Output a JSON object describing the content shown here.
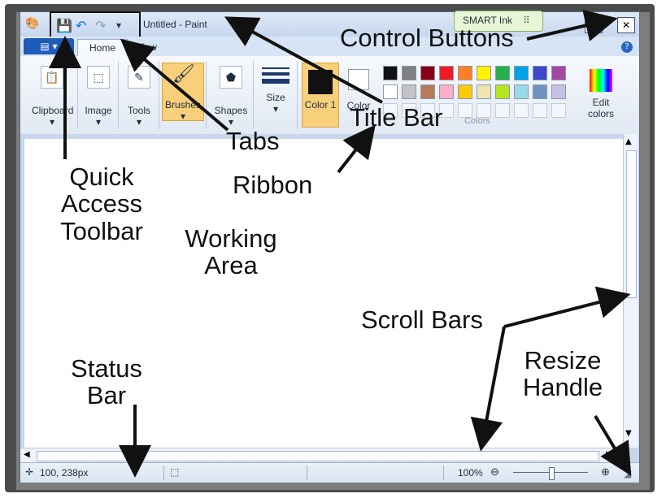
{
  "window": {
    "title": "Untitled - Paint"
  },
  "quick_access": {
    "save_icon": "💾",
    "undo_icon": "↶",
    "redo_icon": "↷",
    "dropdown_icon": "▾"
  },
  "smart_ink": {
    "label": "SMART Ink",
    "icon": "⠿"
  },
  "controls": {
    "minimize": "▭",
    "close": "✕"
  },
  "tabs": {
    "file_icon": "▤ ▾",
    "home": "Home",
    "view": "View"
  },
  "ribbon": {
    "clipboard": "Clipboard",
    "image": "Image",
    "tools": "Tools",
    "brushes": "Brushes",
    "shapes": "Shapes",
    "size": "Size",
    "color1": "Color 1",
    "color2": "Color",
    "colors_group": "Colors",
    "edit_colors": "Edit colors"
  },
  "palette": [
    "#111111",
    "#7f7f7f",
    "#880015",
    "#ed1c24",
    "#ff7f27",
    "#fff200",
    "#22b14c",
    "#00a2e8",
    "#3f48cc",
    "#a349a4",
    "#ffffff",
    "#c3c3c3",
    "#b97a57",
    "#ffaec9",
    "#ffc90e",
    "#efe4b0",
    "#b5e61d",
    "#99d9ea",
    "#7092be",
    "#c8bfe7"
  ],
  "status": {
    "coords": "100, 238px",
    "zoom": "100%"
  },
  "annotations": {
    "control_buttons": "Control Buttons",
    "title_bar": "Title Bar",
    "tabs": "Tabs",
    "ribbon": "Ribbon",
    "quick1": "Quick",
    "quick2": "Access",
    "quick3": "Toolbar",
    "work1": "Working",
    "work2": "Area",
    "scroll": "Scroll Bars",
    "status1": "Status",
    "status2": "Bar",
    "resize1": "Resize",
    "resize2": "Handle"
  }
}
